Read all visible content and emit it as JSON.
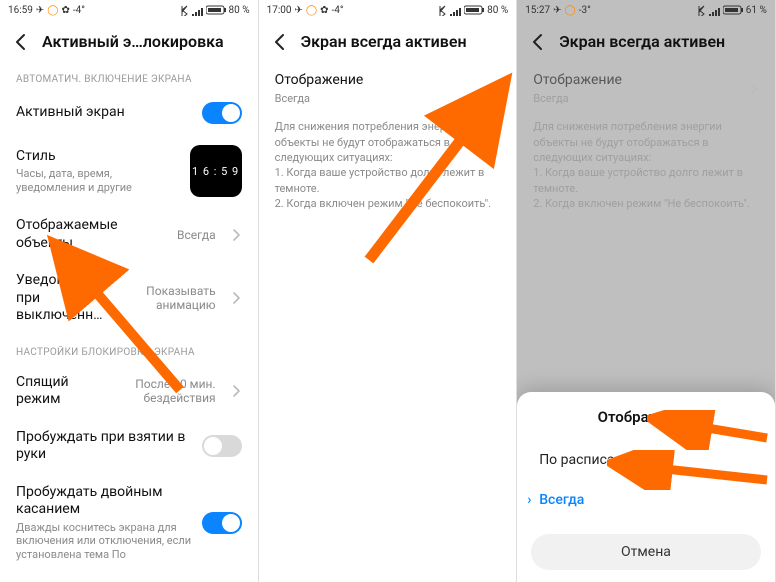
{
  "panel1": {
    "status": {
      "time": "16:59",
      "temp": "-4°",
      "battery": "80 %"
    },
    "header": {
      "title": "Активный э…локировка"
    },
    "section1": "АВТОМАТИЧ. ВКЛЮЧЕНИЕ ЭКРАНА",
    "row_active": {
      "label": "Активный экран"
    },
    "row_style": {
      "label": "Стиль",
      "sub": "Часы, дата, время, уведомления и другие",
      "preview_time": "1 6 : 5 9"
    },
    "row_objects": {
      "label": "Отображаемые объекты",
      "value": "Всегда"
    },
    "row_notif": {
      "label": "Уведомления при выключенн…",
      "value": "Показывать анимацию"
    },
    "section2": "НАСТРОЙКИ БЛОКИРОВКИ ЭКРАНА",
    "row_sleep": {
      "label": "Спящий режим",
      "value": "После 10 мин. бездействия"
    },
    "row_raise": {
      "label": "Пробуждать при взятии в руки"
    },
    "row_doubletap": {
      "label": "Пробуждать двойным касанием",
      "sub": "Дважды коснитесь экрана для включения или отключения, если установлена тема По"
    }
  },
  "panel2": {
    "status": {
      "time": "17:00",
      "temp": "-4°",
      "battery": "80 %"
    },
    "header": {
      "title": "Экран всегда активен"
    },
    "row_display": {
      "label": "Отображение",
      "value": "Всегда"
    },
    "info": {
      "intro": "Для снижения потребления энергии объекты не будут отображаться в следующих ситуациях:",
      "l1": "1. Когда ваше устройство долго лежит в темноте.",
      "l2": "2. Когда включен режим \"Не беспокоить\"."
    }
  },
  "panel3": {
    "status": {
      "time": "15:27",
      "temp": "-3°",
      "battery": "61 %"
    },
    "header": {
      "title": "Экран всегда активен"
    },
    "row_display": {
      "label": "Отображение",
      "value": "Всегда"
    },
    "info": {
      "intro": "Для снижения потребления энергии объекты не будут отображаться в следующих ситуациях:",
      "l1": "1. Когда ваше устройство долго лежит в темноте.",
      "l2": "2. Когда включен режим \"Не беспокоить\"."
    },
    "sheet": {
      "title": "Отображение",
      "opt1": "По расписанию",
      "opt2": "Всегда",
      "cancel": "Отмена"
    }
  }
}
